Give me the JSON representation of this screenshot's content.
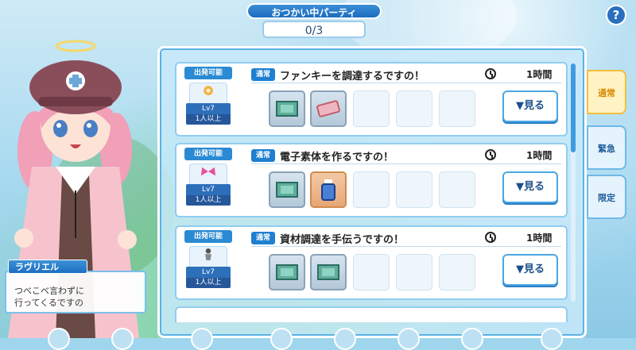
{
  "party": {
    "title": "おつかい中パーティ",
    "count": "0/3"
  },
  "help_label": "?",
  "character": {
    "name": "ラヴリエル",
    "line1": "つべこべ言わずに",
    "line2": "行ってくるですの"
  },
  "tabs": [
    "通常",
    "緊急",
    "限定"
  ],
  "tab_active": 0,
  "missions": [
    {
      "condition": "出発可能",
      "level": "Lv7",
      "members": "1人以上",
      "type": "通常",
      "title": "ファンキーを調達するですの！",
      "duration": "1時間",
      "see": "▼見る",
      "items": [
        "blue",
        "ticket"
      ]
    },
    {
      "condition": "出発可能",
      "level": "Lv7",
      "members": "1人以上",
      "type": "通常",
      "title": "電子素体を作るですの！",
      "duration": "1時間",
      "see": "▼見る",
      "items": [
        "blue",
        "bottle"
      ]
    },
    {
      "condition": "出発可能",
      "level": "Lv7",
      "members": "1人以上",
      "type": "通常",
      "title": "資材調達を手伝うですの！",
      "duration": "1時間",
      "see": "▼見る",
      "items": [
        "blue",
        "blue"
      ]
    }
  ],
  "colors": {
    "accent": "#2a8ad3",
    "active_tab": "#f2bf3c",
    "panel_border": "#5ab2e6"
  }
}
